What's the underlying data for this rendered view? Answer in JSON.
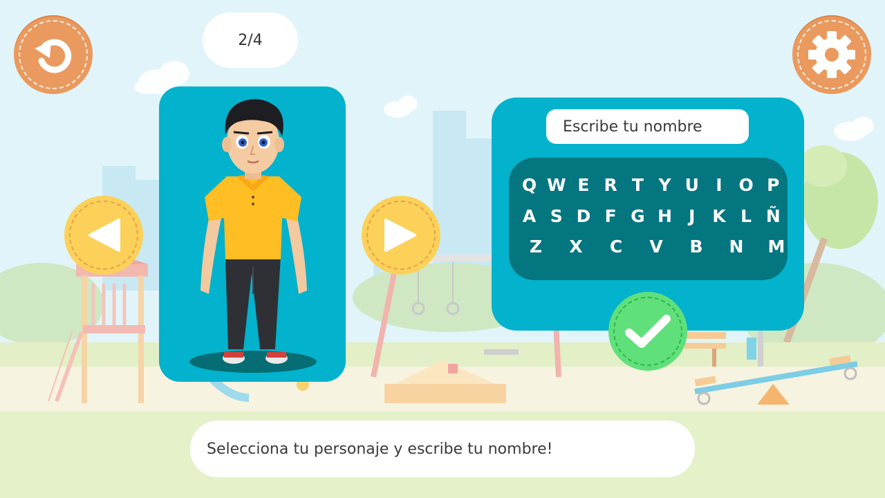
{
  "header": {
    "page_counter": "2/4"
  },
  "icons": {
    "back": "undo-arrow-icon",
    "settings": "gear-icon",
    "prev": "triangle-left-icon",
    "next": "triangle-right-icon",
    "confirm": "checkmark-icon"
  },
  "name_input": {
    "placeholder": "Escribe tu nombre"
  },
  "keyboard": {
    "rows": [
      [
        "Q",
        "W",
        "E",
        "R",
        "T",
        "Y",
        "U",
        "I",
        "O",
        "P"
      ],
      [
        "A",
        "S",
        "D",
        "F",
        "G",
        "H",
        "J",
        "K",
        "L",
        "Ñ"
      ],
      [
        "Z",
        "X",
        "C",
        "V",
        "B",
        "N",
        "M"
      ]
    ]
  },
  "instruction": "Selecciona tu personaje y escribe tu nombre!",
  "colors": {
    "panel": "#03b2cc",
    "keyboard_bg": "#037680",
    "orange_button": "#ea9a5e",
    "yellow_button": "#fbd15a",
    "green_button": "#5fe07a"
  }
}
